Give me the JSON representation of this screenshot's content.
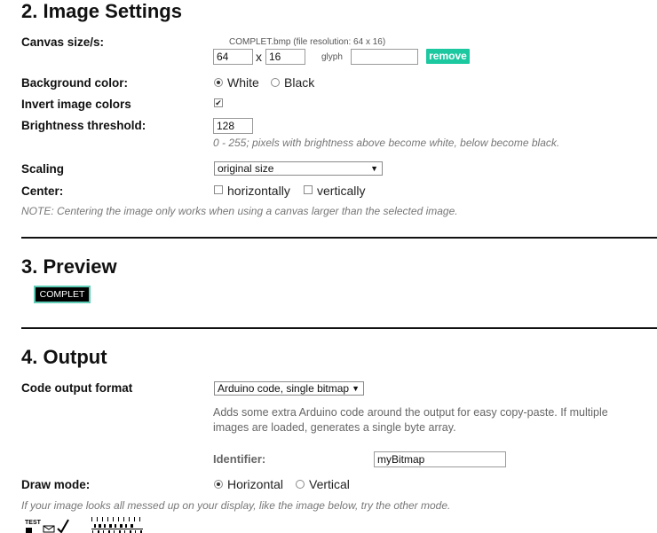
{
  "sections": {
    "settings_title": "2. Image Settings",
    "preview_title": "3. Preview",
    "output_title": "4. Output"
  },
  "canvas": {
    "label": "Canvas size/s:",
    "file_name": "COMPLET.bmp",
    "file_resolution": "(file resolution: 64 x 16)",
    "width": "64",
    "x_sep": "x",
    "height": "16",
    "glyph_label": "glyph",
    "glyph_value": "",
    "remove_label": "remove"
  },
  "background": {
    "label": "Background color:",
    "options": [
      "White",
      "Black"
    ],
    "selected": "White"
  },
  "invert": {
    "label": "Invert image colors",
    "checked": true
  },
  "brightness": {
    "label": "Brightness threshold:",
    "value": "128",
    "hint": "0 - 255; pixels with brightness above become white, below become black."
  },
  "scaling": {
    "label": "Scaling",
    "selected": "original size"
  },
  "center": {
    "label": "Center:",
    "horizontally": "horizontally",
    "vertically": "vertically",
    "note": "NOTE: Centering the image only works when using a canvas larger than the selected image."
  },
  "preview": {
    "text": "COMPLET"
  },
  "output": {
    "format_label": "Code output format",
    "format_selected": "Arduino code, single bitmap",
    "format_hint_line1": "Adds some extra Arduino code around the output for easy copy-paste. If multiple",
    "format_hint_line2": "images are loaded, generates a single byte array.",
    "identifier_label": "Identifier:",
    "identifier_value": "myBitmap"
  },
  "draw_mode": {
    "label": "Draw mode:",
    "options": [
      "Horizontal",
      "Vertical"
    ],
    "selected": "Horizontal",
    "hint": "If your image looks all messed up on your display, like the image below, try the other mode.",
    "example_text": "TEST"
  },
  "colors": {
    "accent": "#1cc8a0",
    "preview_border": "#5fcdb6"
  }
}
